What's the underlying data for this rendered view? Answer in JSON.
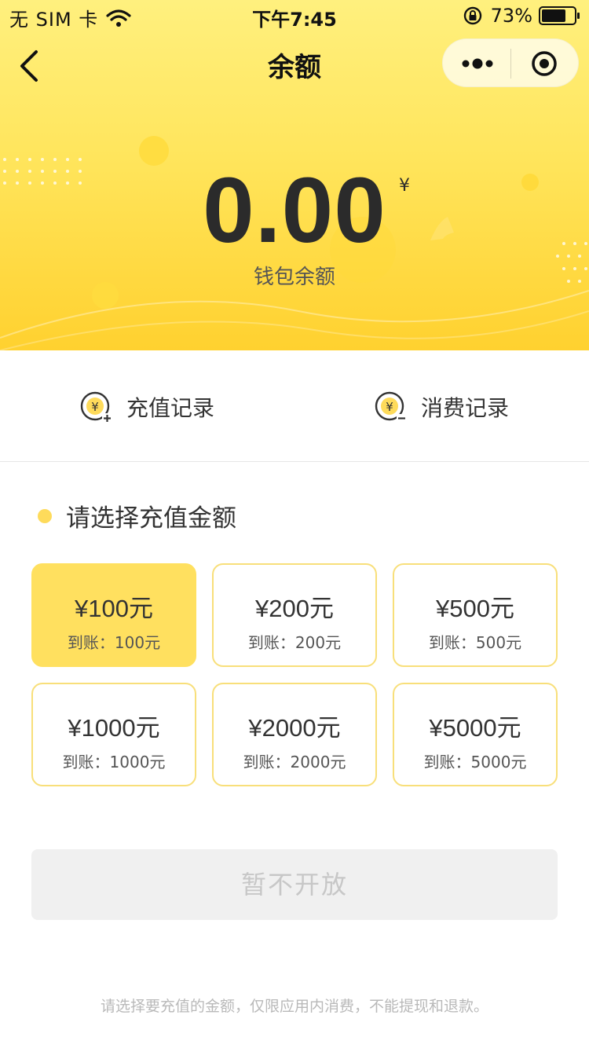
{
  "status_bar": {
    "carrier": "无 SIM 卡",
    "time": "下午7:45",
    "battery": "73%"
  },
  "nav": {
    "title": "余额"
  },
  "balance": {
    "amount": "0.00",
    "currency": "¥",
    "label": "钱包余额"
  },
  "records": {
    "recharge_label": "充值记录",
    "consume_label": "消费记录"
  },
  "section": {
    "title": "请选择充值金额"
  },
  "amounts": [
    {
      "price": "¥100元",
      "arrive": "到账：100元",
      "selected": true
    },
    {
      "price": "¥200元",
      "arrive": "到账：200元",
      "selected": false
    },
    {
      "price": "¥500元",
      "arrive": "到账：500元",
      "selected": false
    },
    {
      "price": "¥1000元",
      "arrive": "到账：1000元",
      "selected": false
    },
    {
      "price": "¥2000元",
      "arrive": "到账：2000元",
      "selected": false
    },
    {
      "price": "¥5000元",
      "arrive": "到账：5000元",
      "selected": false
    }
  ],
  "submit": {
    "label": "暂不开放",
    "disabled": true
  },
  "notice": "请选择要充值的金额，仅限应用内消费，不能提现和退款。",
  "colors": {
    "accent": "#ffe05f",
    "card_border": "#f8df7a",
    "disabled_bg": "#f0f0f0",
    "disabled_text": "#c7c7c7"
  },
  "icons": {
    "back": "chevron-left-icon",
    "more": "more-dots-icon",
    "target": "target-icon",
    "recharge": "yen-plus-icon",
    "consume": "yen-minus-icon"
  }
}
